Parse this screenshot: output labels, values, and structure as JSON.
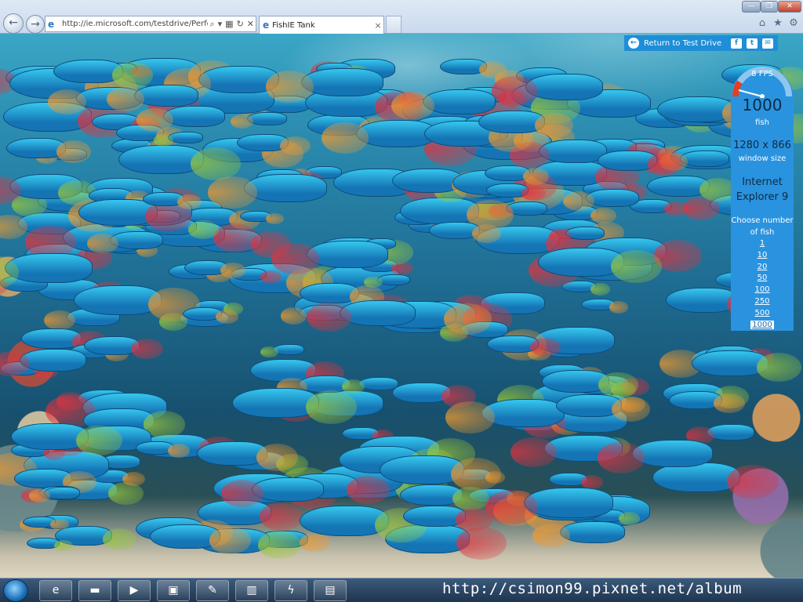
{
  "browser": {
    "address": "http://ie.microsoft.com/testdrive/Perforn",
    "tab_title": "FishIE Tank",
    "tab_close": "×",
    "back_glyph": "←",
    "forward_glyph": "→",
    "window_min": "—",
    "window_max": "❐",
    "window_close": "✕",
    "toolbar_icons": [
      "home-icon",
      "favorites-icon",
      "gear-icon"
    ]
  },
  "test_drive": {
    "return_label": "Return to Test Drive",
    "social_icons": [
      "facebook-icon",
      "twitter-icon",
      "email-icon"
    ]
  },
  "stats": {
    "fps": "8 FPS",
    "fps_gauge_level": 0.08,
    "fish_count": "1000",
    "fish_label": "fish",
    "window_size": "1280 x 866",
    "window_size_label": "window size",
    "browser_name_1": "Internet",
    "browser_name_2": "Explorer 9",
    "choose_label_1": "Choose number",
    "choose_label_2": "of fish",
    "options": [
      "1",
      "10",
      "20",
      "50",
      "100",
      "250",
      "500",
      "1000"
    ],
    "selected_option": "1000"
  },
  "taskbar": {
    "icons": [
      "windows-start-icon",
      "internet-explorer-icon",
      "folder-icon",
      "media-player-icon",
      "monitor-icon",
      "paint-icon",
      "network-icon",
      "flash-icon",
      "cpu-z-icon"
    ]
  },
  "watermark": "http://csimon99.pixnet.net/album",
  "colors": {
    "panel_blue": "#2a93e0",
    "return_bar": "#1e8ed8",
    "gauge_red": "#e2401f"
  }
}
